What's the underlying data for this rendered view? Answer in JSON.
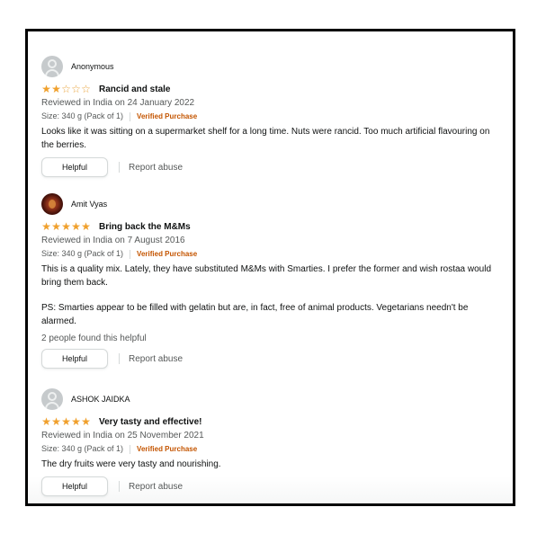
{
  "reviews": [
    {
      "author": "Anonymous",
      "avatar": "default-avatar",
      "rating": 2,
      "max_rating": 5,
      "title": "Rancid and stale",
      "reviewed_line": "Reviewed in India on 24 January 2022",
      "size": "Size: 340 g (Pack of 1)",
      "verified": "Verified Purchase",
      "body": [
        "Looks like it was sitting on a supermarket shelf for a long time. Nuts were rancid. Too much artificial flavouring on the berries."
      ],
      "helpful_count_text": null,
      "helpful_label": "Helpful",
      "report_label": "Report abuse"
    },
    {
      "author": "Amit Vyas",
      "avatar": "photo-avatar",
      "rating": 5,
      "max_rating": 5,
      "title": "Bring back the M&Ms",
      "reviewed_line": "Reviewed in India on 7 August 2016",
      "size": "Size: 340 g (Pack of 1)",
      "verified": "Verified Purchase",
      "body": [
        "This is a quality mix. Lately, they have substituted M&Ms with Smarties. I prefer the former and wish rostaa would bring them back.",
        "PS: Smarties appear to be filled with gelatin but are, in fact, free of animal products. Vegetarians needn't be alarmed."
      ],
      "helpful_count_text": "2 people found this helpful",
      "helpful_label": "Helpful",
      "report_label": "Report abuse"
    },
    {
      "author": "ASHOK JAIDKA",
      "avatar": "default-avatar",
      "rating": 5,
      "max_rating": 5,
      "title": "Very tasty and effective!",
      "reviewed_line": "Reviewed in India on 25 November 2021",
      "size": "Size: 340 g (Pack of 1)",
      "verified": "Verified Purchase",
      "body": [
        "The dry fruits were very tasty and nourishing."
      ],
      "helpful_count_text": null,
      "helpful_label": "Helpful",
      "report_label": "Report abuse"
    }
  ],
  "colors": {
    "star": "#f0a02c",
    "verified": "#c45500",
    "meta_text": "#565959",
    "frame_border": "#000000"
  }
}
